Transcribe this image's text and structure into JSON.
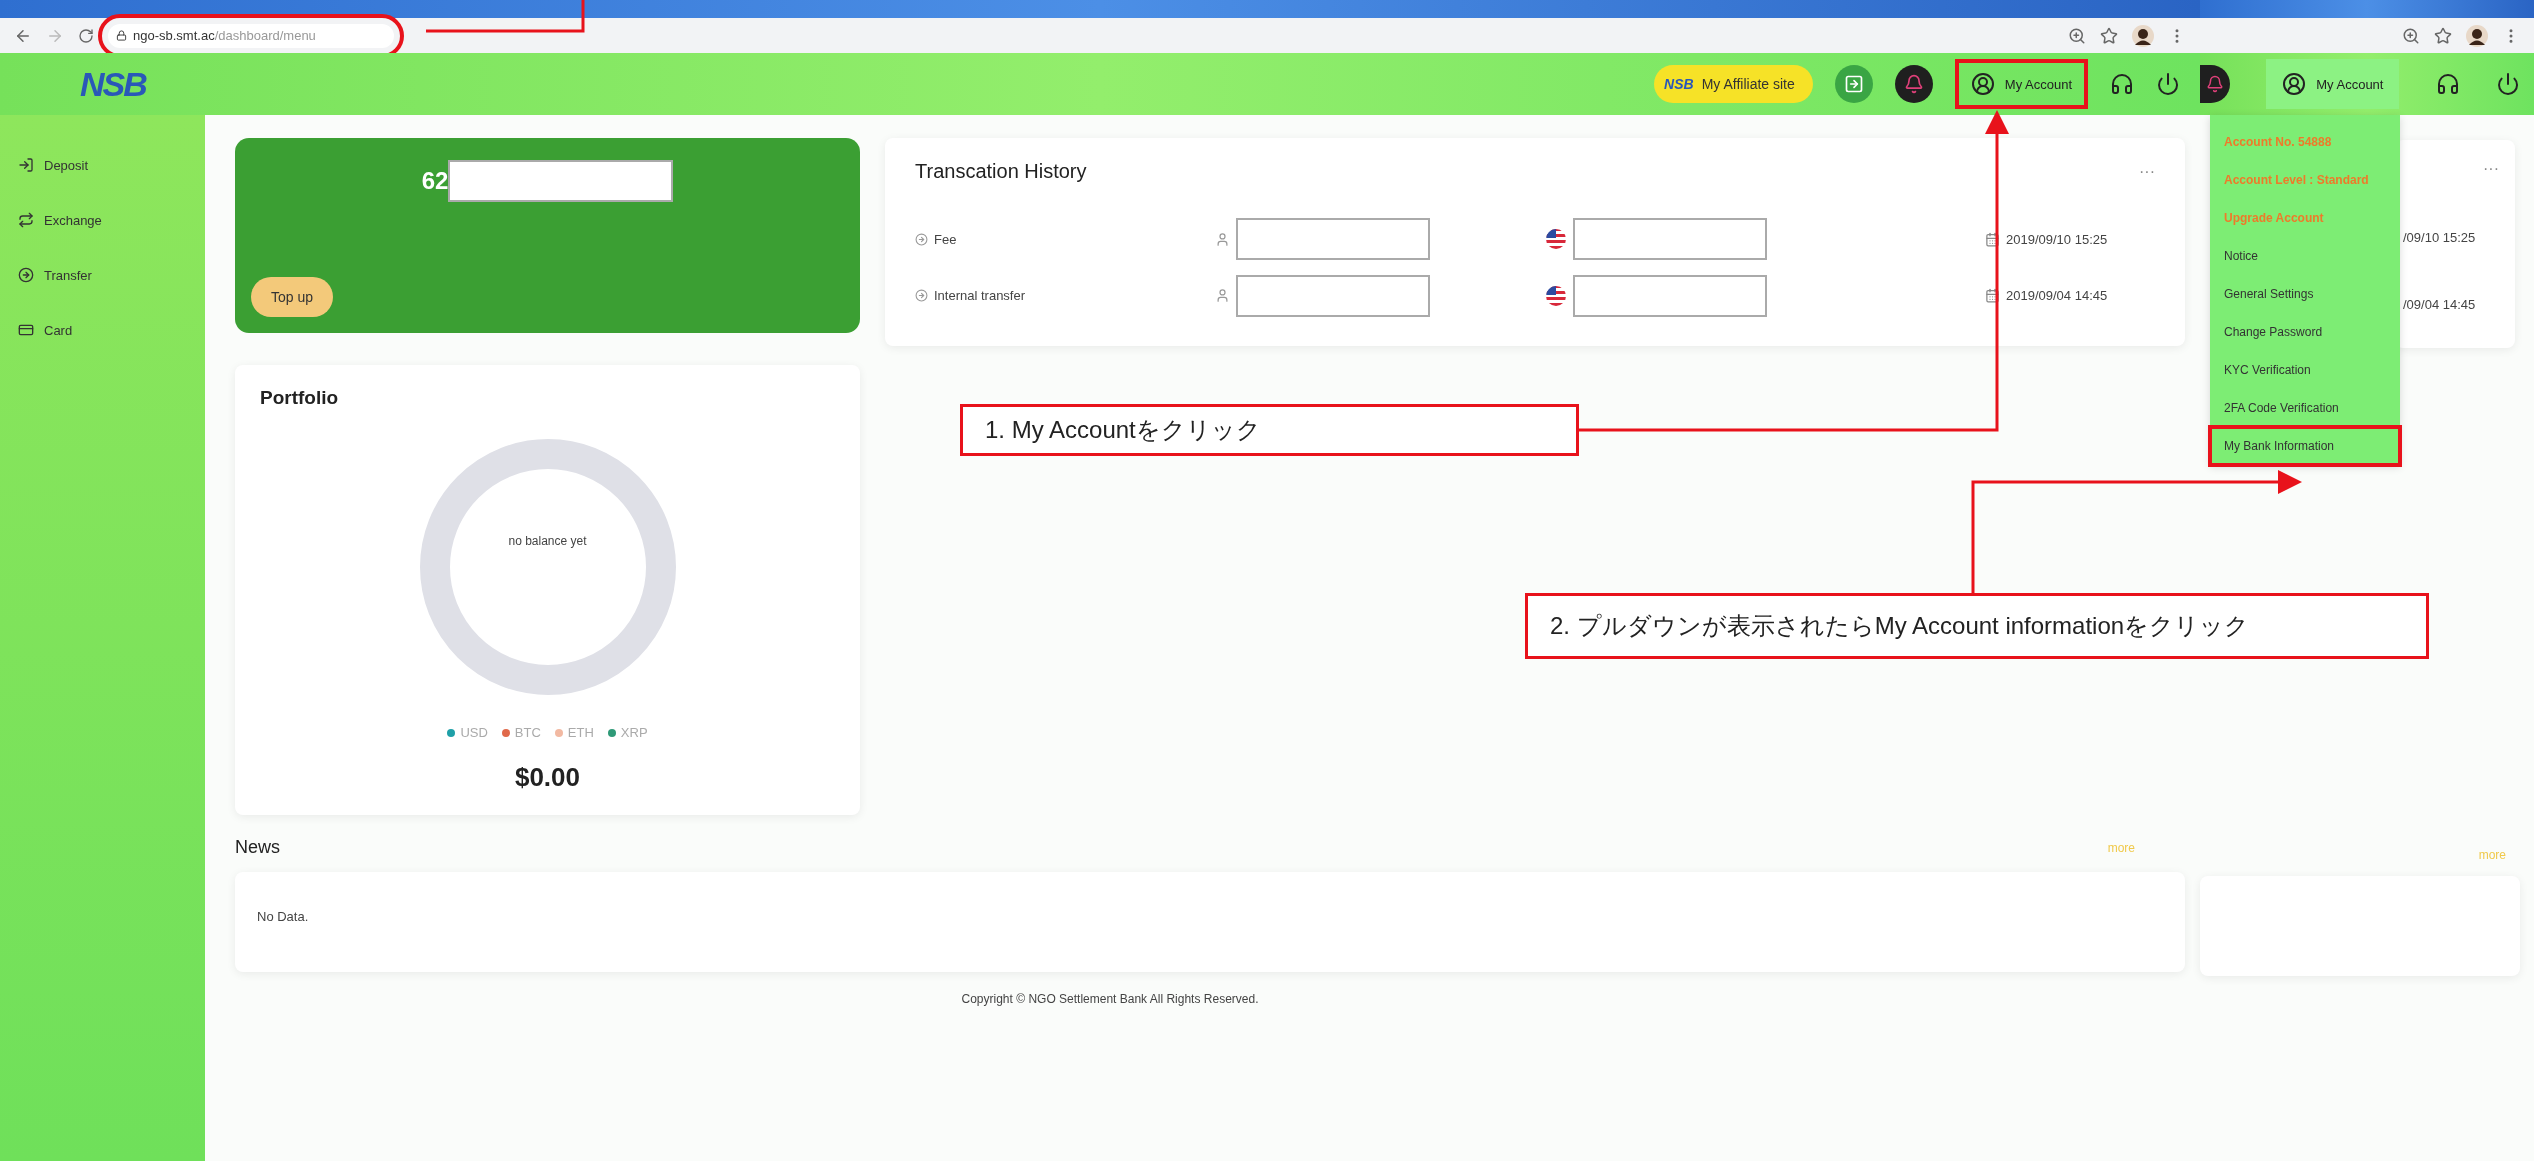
{
  "browser": {
    "url_host": "ngo-sb.smt.ac",
    "url_path": "/dashboard/menu",
    "url_highlighted": true
  },
  "header": {
    "logo_text": "NSB",
    "affiliate_logo": "NSB",
    "affiliate_label": "My Affiliate site",
    "account_label": "My Account",
    "account_highlighted": true
  },
  "sidebar": {
    "items": [
      {
        "label": "Deposit"
      },
      {
        "label": "Exchange"
      },
      {
        "label": "Transfer"
      },
      {
        "label": "Card"
      }
    ]
  },
  "balance_card": {
    "amount_prefix": "62",
    "button": "Top up"
  },
  "transactions": {
    "title": "Transcation History",
    "more": "···",
    "rows": [
      {
        "label": "Fee",
        "date": "2019/09/10 15:25"
      },
      {
        "label": "Internal transfer",
        "date": "2019/09/04 14:45"
      }
    ]
  },
  "portfolio": {
    "title": "Portfolio",
    "center_text": "no balance yet",
    "legend": [
      {
        "label": "USD",
        "color": "#1fa0a8"
      },
      {
        "label": "BTC",
        "color": "#e0694a"
      },
      {
        "label": "ETH",
        "color": "#f2b9a2"
      },
      {
        "label": "XRP",
        "color": "#2f9a78"
      }
    ],
    "total": "$0.00"
  },
  "news": {
    "title": "News",
    "more": "more",
    "empty": "No Data."
  },
  "footer": "Copyright © NGO Settlement Bank All Rights Reserved.",
  "dropdown_view": {
    "account_label": "My Account",
    "more_dots": "···",
    "dates": [
      "/09/10 15:25",
      "/09/04 14:45"
    ],
    "news_more": "more",
    "menu": [
      {
        "label": "Account No. 54888",
        "kind": "info",
        "highlighted": false
      },
      {
        "label": "Account Level : Standard",
        "kind": "info",
        "highlighted": false
      },
      {
        "label": "Upgrade Account",
        "kind": "info",
        "highlighted": false
      },
      {
        "label": "Notice",
        "kind": "link",
        "highlighted": false
      },
      {
        "label": "General Settings",
        "kind": "link",
        "highlighted": false
      },
      {
        "label": "Change Password",
        "kind": "link",
        "highlighted": false
      },
      {
        "label": "KYC Verification",
        "kind": "link",
        "highlighted": false
      },
      {
        "label": "2FA Code Verification",
        "kind": "link",
        "highlighted": false
      },
      {
        "label": "My Bank Information",
        "kind": "link",
        "highlighted": true
      }
    ]
  },
  "annotations": [
    {
      "text": "1.  My Accountをクリック"
    },
    {
      "text": "2. プルダウンが表示されたらMy Account informationをクリック"
    }
  ]
}
